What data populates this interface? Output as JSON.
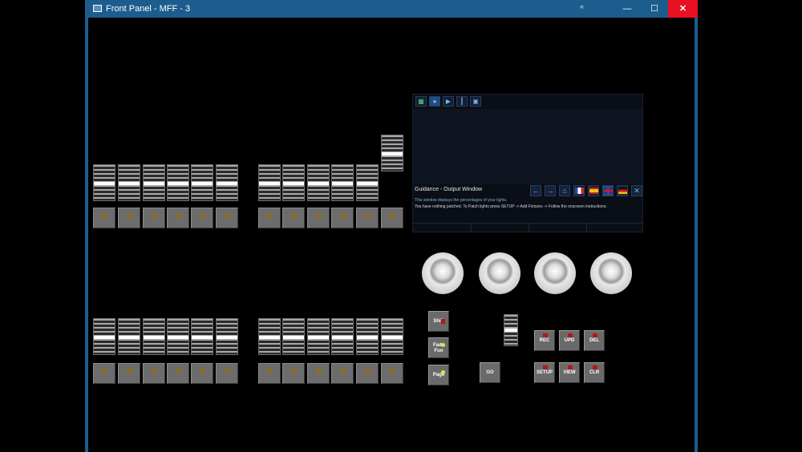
{
  "window": {
    "title": "Front Panel - MFF - 3",
    "pin_glyph": "«",
    "minimize_glyph": "—",
    "maximize_glyph": "☐",
    "close_glyph": "✕"
  },
  "colors": {
    "titlebar": "#1c5d8e",
    "close_hover": "#e81123",
    "fader_knob": "#ffffff",
    "button_led": "#8a6c2e",
    "control_led_red": "#b21818",
    "control_led_yellow": "#e8e04a"
  },
  "output_window": {
    "title": "Guidance - Output Window",
    "line1": "This window displays the percentages of your lights.",
    "line2": "You have nothing patched. To Patch lights press SETUP -> Add Fixtures -> Follow the onscreen instructions.",
    "toolbar_icons": [
      "grid-icon",
      "location-pin-icon",
      "play-pause-icon",
      "faders-icon",
      "tiles-icon"
    ],
    "toolbar_glyphs": [
      "▦",
      "●",
      "▶",
      "┃",
      "▣"
    ],
    "nav_back": "←",
    "nav_forward": "→",
    "nav_home": "⌂",
    "nav_close": "✕",
    "flags": [
      "flag-fr-icon",
      "flag-es-icon",
      "flag-uk-icon",
      "flag-de-icon"
    ]
  },
  "controls": {
    "shift": "Shift",
    "fade_fun": "Fade\nFun",
    "page": "Page",
    "go": "GO",
    "rec": "REC",
    "upd": "UPD",
    "del": "DEL",
    "setup": "SETUP",
    "view": "VIEW",
    "clr": "CLR"
  }
}
